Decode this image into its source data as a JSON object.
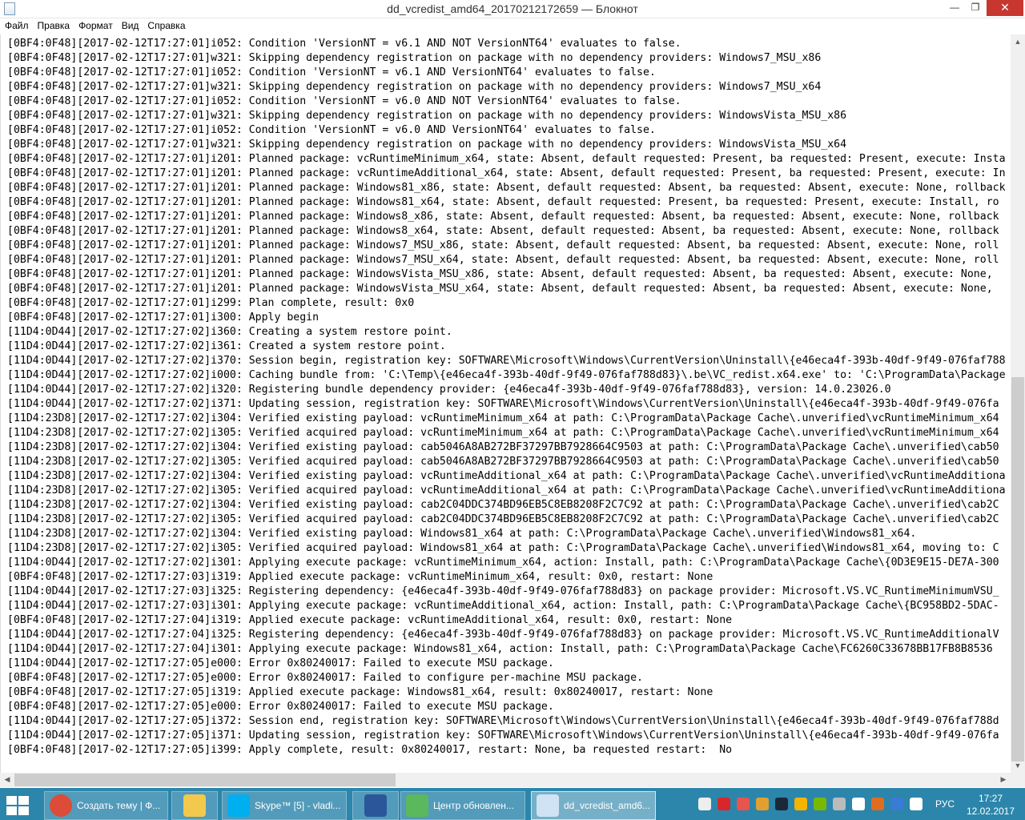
{
  "window": {
    "title": "dd_vcredist_amd64_20170212172659 — Блокнот",
    "minimize": "—",
    "maximize": "❐",
    "close": "✕"
  },
  "menu": [
    "Файл",
    "Правка",
    "Формат",
    "Вид",
    "Справка"
  ],
  "lines": [
    "[0BF4:0F48][2017-02-12T17:27:01]i052: Condition 'VersionNT = v6.1 AND NOT VersionNT64' evaluates to false.",
    "[0BF4:0F48][2017-02-12T17:27:01]w321: Skipping dependency registration on package with no dependency providers: Windows7_MSU_x86",
    "[0BF4:0F48][2017-02-12T17:27:01]i052: Condition 'VersionNT = v6.1 AND VersionNT64' evaluates to false.",
    "[0BF4:0F48][2017-02-12T17:27:01]w321: Skipping dependency registration on package with no dependency providers: Windows7_MSU_x64",
    "[0BF4:0F48][2017-02-12T17:27:01]i052: Condition 'VersionNT = v6.0 AND NOT VersionNT64' evaluates to false.",
    "[0BF4:0F48][2017-02-12T17:27:01]w321: Skipping dependency registration on package with no dependency providers: WindowsVista_MSU_x86",
    "[0BF4:0F48][2017-02-12T17:27:01]i052: Condition 'VersionNT = v6.0 AND VersionNT64' evaluates to false.",
    "[0BF4:0F48][2017-02-12T17:27:01]w321: Skipping dependency registration on package with no dependency providers: WindowsVista_MSU_x64",
    "[0BF4:0F48][2017-02-12T17:27:01]i201: Planned package: vcRuntimeMinimum_x64, state: Absent, default requested: Present, ba requested: Present, execute: Insta",
    "[0BF4:0F48][2017-02-12T17:27:01]i201: Planned package: vcRuntimeAdditional_x64, state: Absent, default requested: Present, ba requested: Present, execute: In",
    "[0BF4:0F48][2017-02-12T17:27:01]i201: Planned package: Windows81_x86, state: Absent, default requested: Absent, ba requested: Absent, execute: None, rollback",
    "[0BF4:0F48][2017-02-12T17:27:01]i201: Planned package: Windows81_x64, state: Absent, default requested: Present, ba requested: Present, execute: Install, ro",
    "[0BF4:0F48][2017-02-12T17:27:01]i201: Planned package: Windows8_x86, state: Absent, default requested: Absent, ba requested: Absent, execute: None, rollback",
    "[0BF4:0F48][2017-02-12T17:27:01]i201: Planned package: Windows8_x64, state: Absent, default requested: Absent, ba requested: Absent, execute: None, rollback",
    "[0BF4:0F48][2017-02-12T17:27:01]i201: Planned package: Windows7_MSU_x86, state: Absent, default requested: Absent, ba requested: Absent, execute: None, roll",
    "[0BF4:0F48][2017-02-12T17:27:01]i201: Planned package: Windows7_MSU_x64, state: Absent, default requested: Absent, ba requested: Absent, execute: None, roll",
    "[0BF4:0F48][2017-02-12T17:27:01]i201: Planned package: WindowsVista_MSU_x86, state: Absent, default requested: Absent, ba requested: Absent, execute: None,",
    "[0BF4:0F48][2017-02-12T17:27:01]i201: Planned package: WindowsVista_MSU_x64, state: Absent, default requested: Absent, ba requested: Absent, execute: None,",
    "[0BF4:0F48][2017-02-12T17:27:01]i299: Plan complete, result: 0x0",
    "[0BF4:0F48][2017-02-12T17:27:01]i300: Apply begin",
    "[11D4:0D44][2017-02-12T17:27:02]i360: Creating a system restore point.",
    "[11D4:0D44][2017-02-12T17:27:02]i361: Created a system restore point.",
    "[11D4:0D44][2017-02-12T17:27:02]i370: Session begin, registration key: SOFTWARE\\Microsoft\\Windows\\CurrentVersion\\Uninstall\\{e46eca4f-393b-40df-9f49-076faf788",
    "[11D4:0D44][2017-02-12T17:27:02]i000: Caching bundle from: 'C:\\Temp\\{e46eca4f-393b-40df-9f49-076faf788d83}\\.be\\VC_redist.x64.exe' to: 'C:\\ProgramData\\Package",
    "[11D4:0D44][2017-02-12T17:27:02]i320: Registering bundle dependency provider: {e46eca4f-393b-40df-9f49-076faf788d83}, version: 14.0.23026.0",
    "[11D4:0D44][2017-02-12T17:27:02]i371: Updating session, registration key: SOFTWARE\\Microsoft\\Windows\\CurrentVersion\\Uninstall\\{e46eca4f-393b-40df-9f49-076fa",
    "[11D4:23D8][2017-02-12T17:27:02]i304: Verified existing payload: vcRuntimeMinimum_x64 at path: C:\\ProgramData\\Package Cache\\.unverified\\vcRuntimeMinimum_x64",
    "[11D4:23D8][2017-02-12T17:27:02]i305: Verified acquired payload: vcRuntimeMinimum_x64 at path: C:\\ProgramData\\Package Cache\\.unverified\\vcRuntimeMinimum_x64",
    "[11D4:23D8][2017-02-12T17:27:02]i304: Verified existing payload: cab5046A8AB272BF37297BB7928664C9503 at path: C:\\ProgramData\\Package Cache\\.unverified\\cab50",
    "[11D4:23D8][2017-02-12T17:27:02]i305: Verified acquired payload: cab5046A8AB272BF37297BB7928664C9503 at path: C:\\ProgramData\\Package Cache\\.unverified\\cab50",
    "[11D4:23D8][2017-02-12T17:27:02]i304: Verified existing payload: vcRuntimeAdditional_x64 at path: C:\\ProgramData\\Package Cache\\.unverified\\vcRuntimeAdditiona",
    "[11D4:23D8][2017-02-12T17:27:02]i305: Verified acquired payload: vcRuntimeAdditional_x64 at path: C:\\ProgramData\\Package Cache\\.unverified\\vcRuntimeAdditiona",
    "[11D4:23D8][2017-02-12T17:27:02]i304: Verified existing payload: cab2C04DDC374BD96EB5C8EB8208F2C7C92 at path: C:\\ProgramData\\Package Cache\\.unverified\\cab2C",
    "[11D4:23D8][2017-02-12T17:27:02]i305: Verified acquired payload: cab2C04DDC374BD96EB5C8EB8208F2C7C92 at path: C:\\ProgramData\\Package Cache\\.unverified\\cab2C",
    "[11D4:23D8][2017-02-12T17:27:02]i304: Verified existing payload: Windows81_x64 at path: C:\\ProgramData\\Package Cache\\.unverified\\Windows81_x64.",
    "[11D4:23D8][2017-02-12T17:27:02]i305: Verified acquired payload: Windows81_x64 at path: C:\\ProgramData\\Package Cache\\.unverified\\Windows81_x64, moving to: C",
    "[11D4:0D44][2017-02-12T17:27:02]i301: Applying execute package: vcRuntimeMinimum_x64, action: Install, path: C:\\ProgramData\\Package Cache\\{0D3E9E15-DE7A-300",
    "[0BF4:0F48][2017-02-12T17:27:03]i319: Applied execute package: vcRuntimeMinimum_x64, result: 0x0, restart: None",
    "[11D4:0D44][2017-02-12T17:27:03]i325: Registering dependency: {e46eca4f-393b-40df-9f49-076faf788d83} on package provider: Microsoft.VS.VC_RuntimeMinimumVSU_",
    "[11D4:0D44][2017-02-12T17:27:03]i301: Applying execute package: vcRuntimeAdditional_x64, action: Install, path: C:\\ProgramData\\Package Cache\\{BC958BD2-5DAC-",
    "[0BF4:0F48][2017-02-12T17:27:04]i319: Applied execute package: vcRuntimeAdditional_x64, result: 0x0, restart: None",
    "[11D4:0D44][2017-02-12T17:27:04]i325: Registering dependency: {e46eca4f-393b-40df-9f49-076faf788d83} on package provider: Microsoft.VS.VC_RuntimeAdditionalV",
    "[11D4:0D44][2017-02-12T17:27:04]i301: Applying execute package: Windows81_x64, action: Install, path: C:\\ProgramData\\Package Cache\\FC6260C33678BB17FB8B8536",
    "[11D4:0D44][2017-02-12T17:27:05]e000: Error 0x80240017: Failed to execute MSU package.",
    "[0BF4:0F48][2017-02-12T17:27:05]e000: Error 0x80240017: Failed to configure per-machine MSU package.",
    "[0BF4:0F48][2017-02-12T17:27:05]i319: Applied execute package: Windows81_x64, result: 0x80240017, restart: None",
    "[0BF4:0F48][2017-02-12T17:27:05]e000: Error 0x80240017: Failed to execute MSU package.",
    "[11D4:0D44][2017-02-12T17:27:05]i372: Session end, registration key: SOFTWARE\\Microsoft\\Windows\\CurrentVersion\\Uninstall\\{e46eca4f-393b-40df-9f49-076faf788d",
    "[11D4:0D44][2017-02-12T17:27:05]i371: Updating session, registration key: SOFTWARE\\Microsoft\\Windows\\CurrentVersion\\Uninstall\\{e46eca4f-393b-40df-9f49-076fa",
    "[0BF4:0F48][2017-02-12T17:27:05]i399: Apply complete, result: 0x80240017, restart: None, ba requested restart:  No"
  ],
  "taskbar": {
    "items": [
      {
        "label": "Создать тему | Ф...",
        "icon": "chrome-icon",
        "color": "#dd4b39"
      },
      {
        "label": "",
        "icon": "file-explorer-icon",
        "color": "#f2c94c"
      },
      {
        "label": "Skype™ [5] - vladi...",
        "icon": "skype-icon",
        "color": "#00aff0"
      },
      {
        "label": "",
        "icon": "word-icon",
        "color": "#2b579a"
      },
      {
        "label": "Центр обновлен...",
        "icon": "windows-update-icon",
        "color": "#5cb85c"
      },
      {
        "label": "dd_vcredist_amd6...",
        "icon": "notepad-icon",
        "color": "#cfe3f5"
      }
    ],
    "tray_icons": [
      {
        "icon": "network-icon",
        "color": "#eeeeee"
      },
      {
        "icon": "kaspersky-icon",
        "color": "#d9262b"
      },
      {
        "icon": "volume-icon",
        "color": "#e8554e"
      },
      {
        "icon": "rubik-icon",
        "color": "#e0a030"
      },
      {
        "icon": "steam-icon",
        "color": "#1b2838"
      },
      {
        "icon": "skype-status-icon",
        "color": "#f5b400"
      },
      {
        "icon": "nvidia-icon",
        "color": "#76b900"
      },
      {
        "icon": "printer-icon",
        "color": "#bbbbbb"
      },
      {
        "icon": "action-center-flag-icon",
        "color": "#ffffff"
      },
      {
        "icon": "book-icon",
        "color": "#e06d1f"
      },
      {
        "icon": "key-icon",
        "color": "#3a7bd5"
      },
      {
        "icon": "network-computer-icon",
        "color": "#ffffff"
      }
    ],
    "language": "РУС",
    "time": "17:27",
    "date": "12.02.2017"
  }
}
